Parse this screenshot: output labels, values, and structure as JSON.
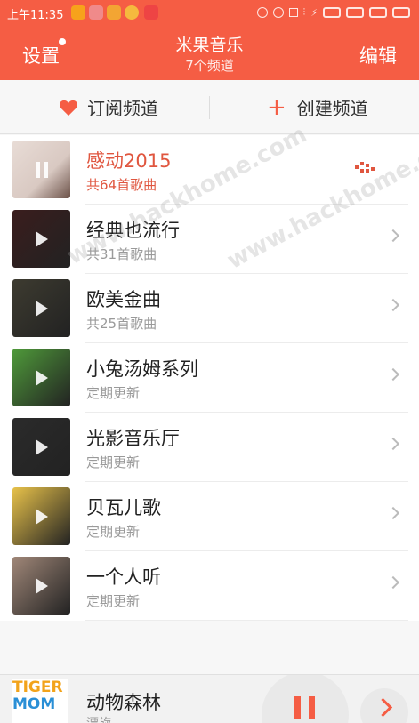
{
  "status_bar": {
    "time": "上午11:35"
  },
  "header": {
    "settings_label": "设置",
    "title": "米果音乐",
    "subtitle": "7个频道",
    "edit_label": "编辑"
  },
  "actions": {
    "subscribe_label": "订阅频道",
    "create_label": "创建频道"
  },
  "channels": [
    {
      "name": "感动2015",
      "info": "共64首歌曲",
      "playing": true,
      "thumb_color": "#d9c9c2"
    },
    {
      "name": "经典也流行",
      "info": "共31首歌曲",
      "playing": false,
      "thumb_color": "#3a1d1d"
    },
    {
      "name": "欧美金曲",
      "info": "共25首歌曲",
      "playing": false,
      "thumb_color": "#3d3b30"
    },
    {
      "name": "小兔汤姆系列",
      "info": "定期更新",
      "playing": false,
      "thumb_color": "#4f9a3a"
    },
    {
      "name": "光影音乐厅",
      "info": "定期更新",
      "playing": false,
      "thumb_color": "#2b2b2b"
    },
    {
      "name": "贝瓦儿歌",
      "info": "定期更新",
      "playing": false,
      "thumb_color": "#e8c24a"
    },
    {
      "name": "一个人听",
      "info": "定期更新",
      "playing": false,
      "thumb_color": "#a08778"
    }
  ],
  "watermark": "www.hackhome.com",
  "player": {
    "title": "动物森林",
    "subtitle": "漂旋",
    "thumb_text_top": "TIGER",
    "thumb_text_bottom": "MOM"
  },
  "colors": {
    "accent": "#f55d44",
    "active_text": "#e0563f"
  }
}
